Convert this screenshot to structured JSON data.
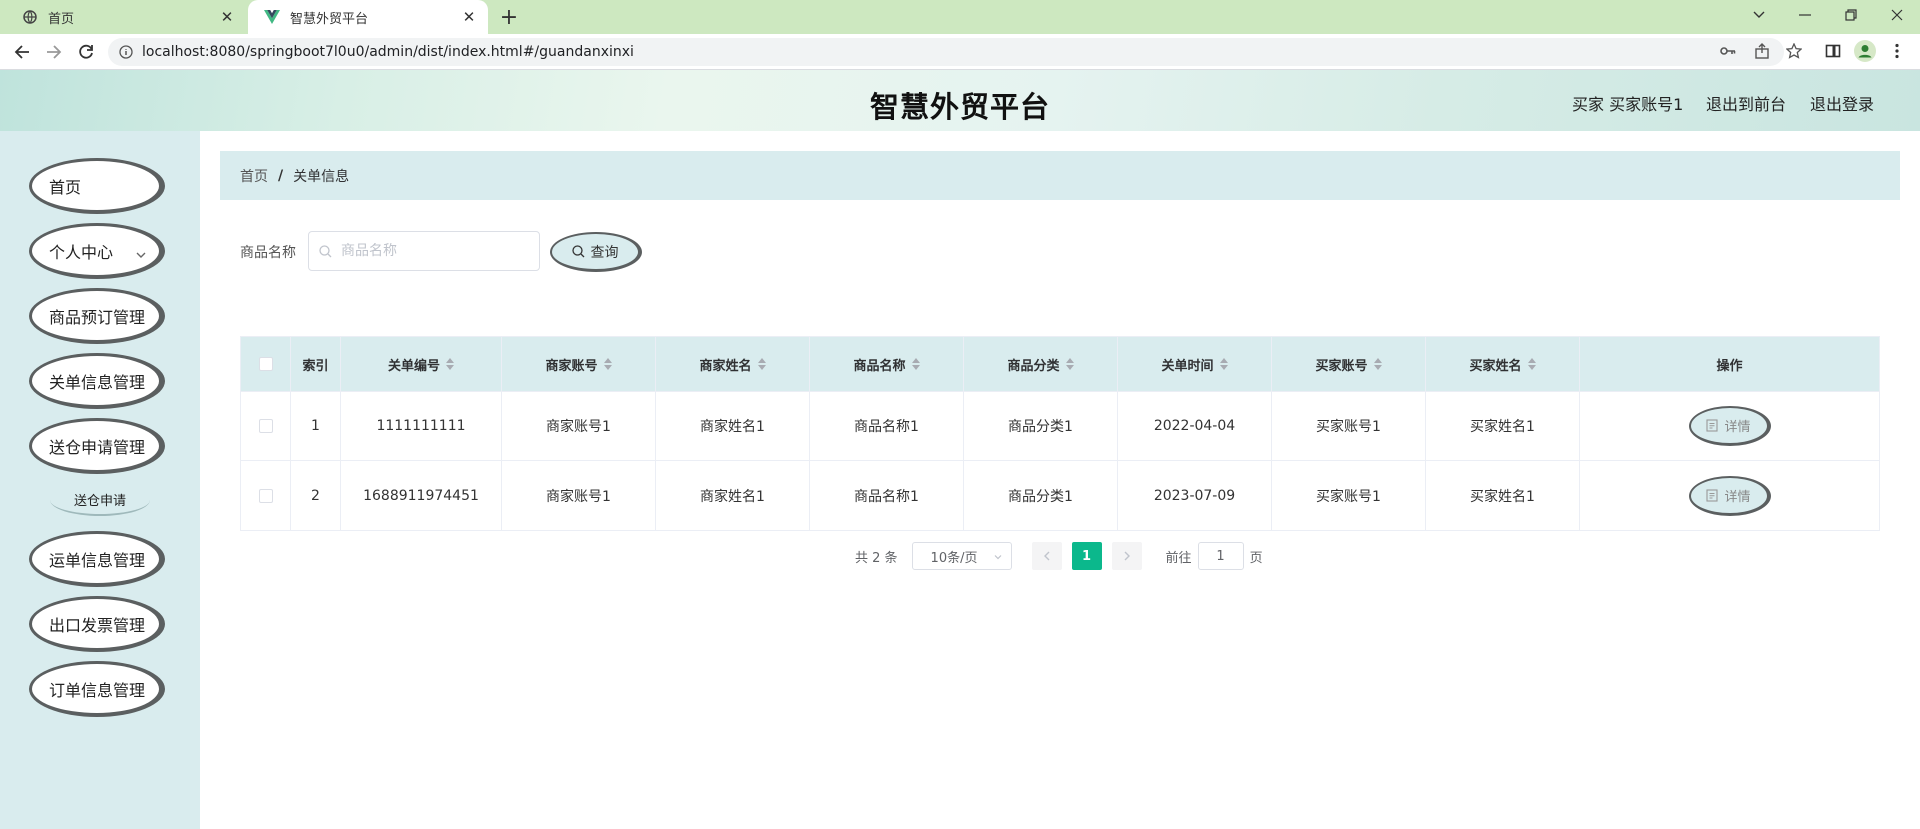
{
  "browser": {
    "tabs": [
      {
        "title": "首页",
        "icon": "globe-icon",
        "active": false
      },
      {
        "title": "智慧外贸平台",
        "icon": "vue-logo-icon",
        "active": true
      }
    ],
    "url": "localhost:8080/springboot7l0u0/admin/dist/index.html#/guandanxinxi"
  },
  "header": {
    "title": "智慧外贸平台",
    "user_info": "买家 买家账号1",
    "to_front": "退出到前台",
    "logout": "退出登录"
  },
  "sidebar": {
    "items": [
      {
        "label": "首页"
      },
      {
        "label": "个人中心",
        "has_arrow": true
      },
      {
        "label": "商品预订管理"
      },
      {
        "label": "关单信息管理"
      },
      {
        "label": "送仓申请管理"
      },
      {
        "label": "运单信息管理"
      },
      {
        "label": "出口发票管理"
      },
      {
        "label": "订单信息管理"
      }
    ],
    "submenu": {
      "label": "送仓申请"
    }
  },
  "breadcrumb": {
    "home": "首页",
    "separator": "/",
    "current": "关单信息"
  },
  "search": {
    "label": "商品名称",
    "placeholder": "商品名称",
    "value": "",
    "button": "查询"
  },
  "table": {
    "columns": [
      "索引",
      "关单编号",
      "商家账号",
      "商家姓名",
      "商品名称",
      "商品分类",
      "关单时间",
      "买家账号",
      "买家姓名",
      "操作"
    ],
    "rows": [
      [
        "1",
        "1111111111",
        "商家账号1",
        "商家姓名1",
        "商品名称1",
        "商品分类1",
        "2022-04-04",
        "买家账号1",
        "买家姓名1"
      ],
      [
        "2",
        "1688911974451",
        "商家账号1",
        "商家姓名1",
        "商品名称1",
        "商品分类1",
        "2023-07-09",
        "买家账号1",
        "买家姓名1"
      ]
    ],
    "action_label": "详情"
  },
  "pagination": {
    "total": "共 2 条",
    "page_size": "10条/页",
    "current_page": "1",
    "goto_prefix": "前往",
    "goto_value": "1",
    "goto_suffix": "页"
  },
  "colors": {
    "accent": "#0bb88c",
    "panel_bg": "#d9ecee",
    "tab_strip": "#cde8c0"
  }
}
